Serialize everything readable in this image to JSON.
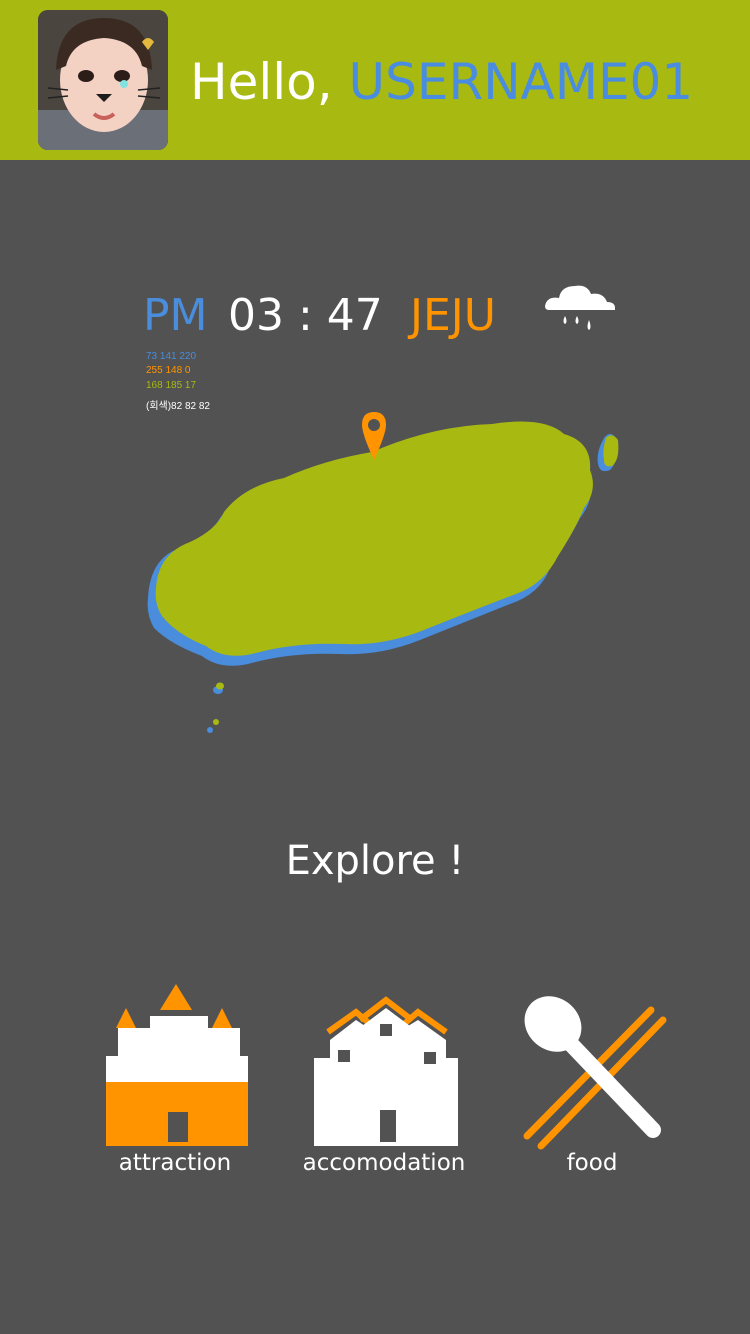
{
  "header": {
    "greeting": "Hello,",
    "username": "USERNAME01",
    "avatar_icon": "profile-photo"
  },
  "status": {
    "ampm": "PM",
    "time": "03 : 47",
    "city": "JEJU",
    "weather_icon": "rain-cloud-icon"
  },
  "notes": {
    "blue": "73 141 220",
    "orange": "255 148 0",
    "green": "168 185 17",
    "gray": "(회색)82 82 82"
  },
  "explore": {
    "title": "Explore !",
    "categories": [
      {
        "label": "attraction",
        "icon": "palace-icon"
      },
      {
        "label": "accomodation",
        "icon": "houses-icon"
      },
      {
        "label": "food",
        "icon": "spoon-chopsticks-icon"
      }
    ]
  },
  "colors": {
    "header_bg": "#a8b911",
    "background": "#525252",
    "blue": "#498ddc",
    "orange": "#ff9400",
    "green": "#a8b911",
    "white": "#ffffff"
  }
}
